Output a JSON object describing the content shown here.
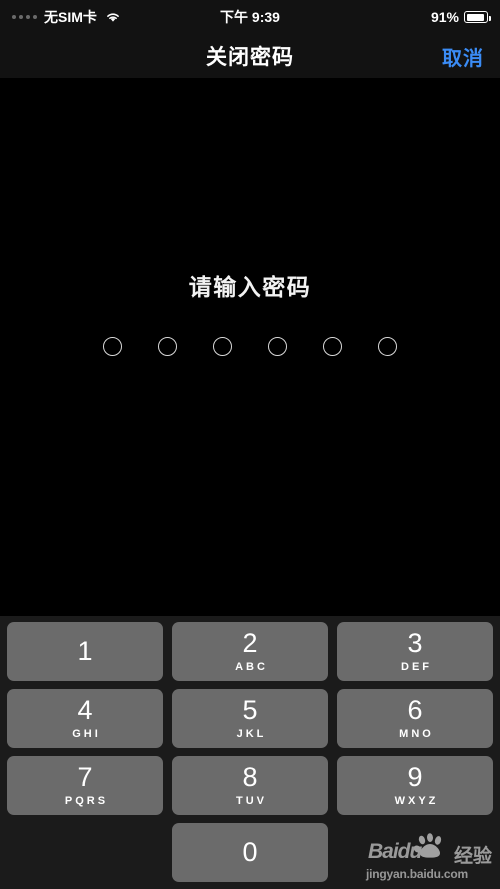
{
  "colors": {
    "screen_background": "#000000",
    "bar_background": "#121212",
    "keypad_background": "#1b1b1b",
    "key_fill": "#6b6b6b",
    "accent_blue": "#3b8cf5",
    "text_primary": "#ffffff"
  },
  "status_bar": {
    "signal_dots": 4,
    "carrier": "无SIM卡",
    "wifi_icon": "wifi-icon",
    "time": "下午 9:39",
    "battery_percent": "91%",
    "battery_level": 91,
    "battery_icon": "battery-icon"
  },
  "nav_bar": {
    "title": "关闭密码",
    "cancel_label": "取消"
  },
  "passcode": {
    "prompt": "请输入密码",
    "length": 6,
    "entered": 0
  },
  "keypad": {
    "rows": [
      [
        {
          "digit": "1",
          "letters": ""
        },
        {
          "digit": "2",
          "letters": "ABC"
        },
        {
          "digit": "3",
          "letters": "DEF"
        }
      ],
      [
        {
          "digit": "4",
          "letters": "GHI"
        },
        {
          "digit": "5",
          "letters": "JKL"
        },
        {
          "digit": "6",
          "letters": "MNO"
        }
      ],
      [
        {
          "digit": "7",
          "letters": "PQRS"
        },
        {
          "digit": "8",
          "letters": "TUV"
        },
        {
          "digit": "9",
          "letters": "WXYZ"
        }
      ]
    ],
    "zero": {
      "digit": "0",
      "letters": ""
    }
  },
  "watermark": {
    "brand": "Baidu",
    "brand_cn": "经验",
    "url": "jingyan.baidu.com",
    "icon": "baidu-paw-icon"
  }
}
